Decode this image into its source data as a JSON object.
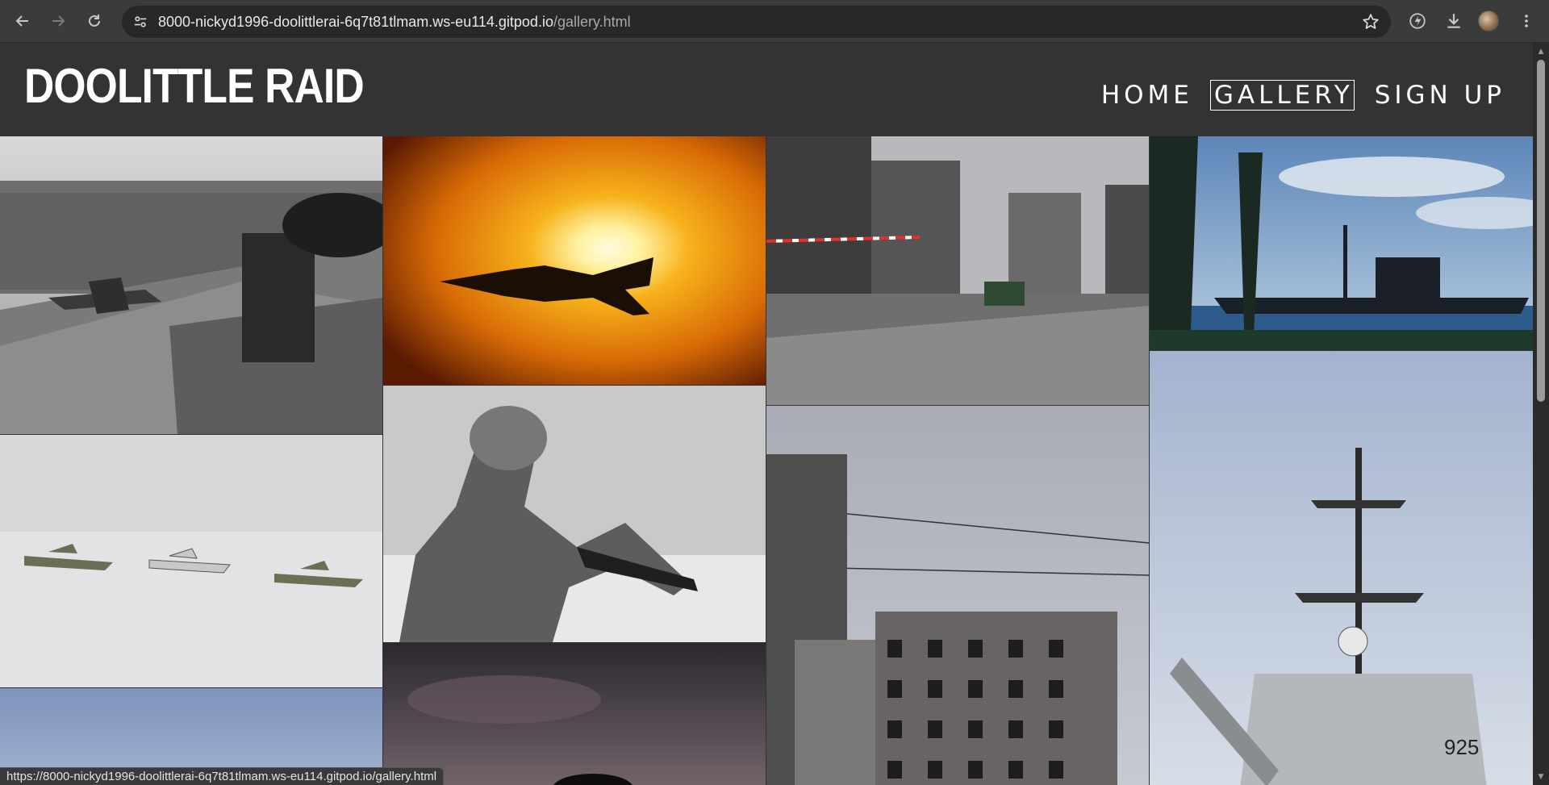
{
  "browser": {
    "url_host": "8000-nickyd1996-doolittlerai-6q7t81tlmam.ws-eu114.gitpod.io",
    "url_path": "/gallery.html",
    "status_url": "https://8000-nickyd1996-doolittlerai-6q7t81tlmam.ws-eu114.gitpod.io/gallery.html",
    "icons": [
      "back-arrow-icon",
      "forward-arrow-icon",
      "reload-icon",
      "site-info-icon",
      "bookmark-star-icon",
      "performance-icon",
      "download-icon",
      "profile-avatar",
      "kebab-menu-icon"
    ]
  },
  "site": {
    "logo": "DOOLITTLE RAID",
    "nav": [
      {
        "label": "HOME",
        "active": false
      },
      {
        "label": "GALLERY",
        "active": true
      },
      {
        "label": "SIGN UP",
        "active": false
      }
    ]
  },
  "colors": {
    "header_bg": "#333333",
    "text": "#ffffff",
    "browser_bg": "#3b3b3b"
  }
}
